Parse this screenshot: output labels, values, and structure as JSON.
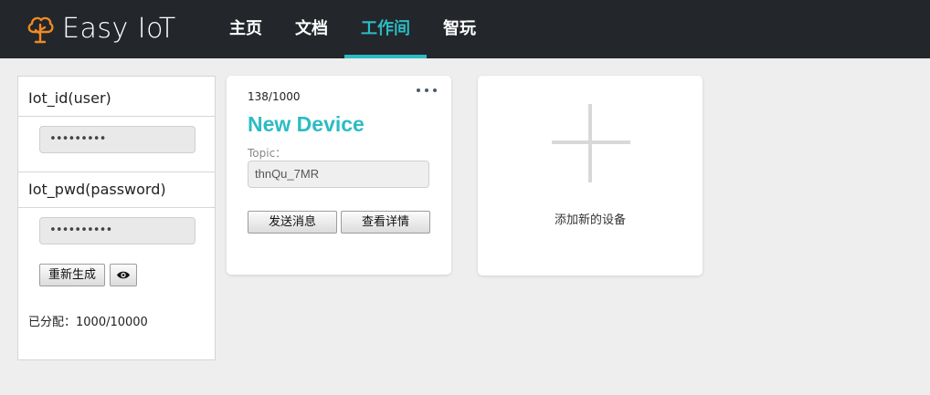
{
  "header": {
    "brand": "Easy IoT",
    "nav": [
      {
        "label": "主页",
        "active": false
      },
      {
        "label": "文档",
        "active": false
      },
      {
        "label": "工作间",
        "active": true
      },
      {
        "label": "智玩",
        "active": false
      }
    ]
  },
  "credentials": {
    "iot_id_label": "Iot_id(user)",
    "iot_id_value": "•••••••••",
    "iot_pwd_label": "Iot_pwd(password)",
    "iot_pwd_value": "••••••••••",
    "regenerate_label": "重新生成",
    "allocated_text": "已分配：1000/10000"
  },
  "device": {
    "count": "138/1000",
    "name": "New Device",
    "topic_label": "Topic：",
    "topic_value": "thnQu_7MR",
    "send_label": "发送消息",
    "detail_label": "查看详情"
  },
  "add_device": {
    "label": "添加新的设备"
  },
  "colors": {
    "accent": "#2bbcc4",
    "header_bg": "#23272b",
    "brand_icon": "#f08a24"
  }
}
